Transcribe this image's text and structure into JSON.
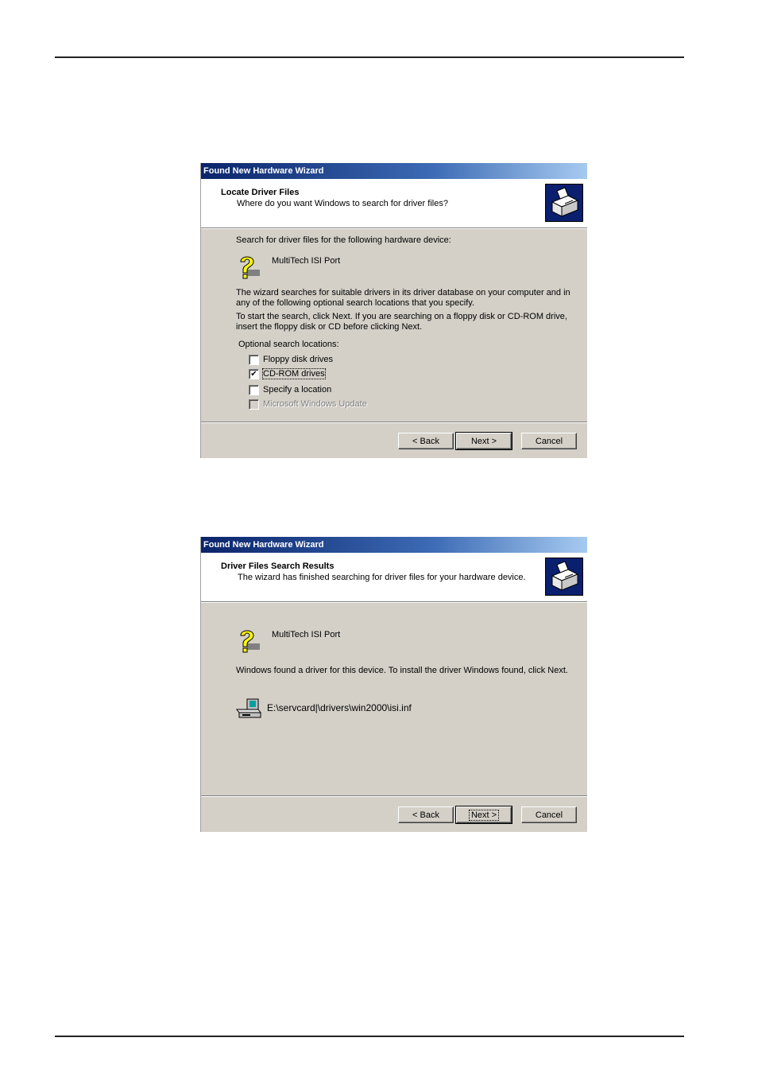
{
  "dialog1": {
    "title": "Found New Hardware Wizard",
    "header_title": "Locate Driver Files",
    "header_subtitle": "Where do you want Windows to search for driver files?",
    "intro": "Search for driver files for the following hardware device:",
    "device_name": "MultiTech ISI Port",
    "para1_line1": "The wizard searches for suitable drivers in its driver database on your computer and in",
    "para1_line2": "any of the following optional search locations that you specify.",
    "para2_line1": "To start the search, click Next. If you are searching on a floppy disk or CD-ROM drive,",
    "para2_line2": "insert the floppy disk or CD before clicking Next.",
    "optional_label": "Optional search locations:",
    "options": [
      {
        "label": "Floppy disk drives",
        "checked": "false"
      },
      {
        "label": "CD-ROM drives",
        "checked": "true"
      },
      {
        "label": "Specify a location",
        "checked": "false"
      },
      {
        "label": "Microsoft Windows Update",
        "checked": "false"
      }
    ],
    "back_label": "< Back",
    "next_label": "Next >",
    "cancel_label": "Cancel"
  },
  "dialog2": {
    "title": "Found New Hardware Wizard",
    "header_title": "Driver Files Search Results",
    "header_subtitle": "The wizard has finished searching for driver files for your hardware device.",
    "device_name": "MultiTech ISI Port",
    "message": "Windows found a driver for this device. To install the driver Windows found, click Next.",
    "driver_path": "E:\\servcard|\\drivers\\win2000\\isi.inf",
    "back_label": "< Back",
    "next_label": "Next >",
    "cancel_label": "Cancel"
  },
  "icons": {
    "wizard": "hardware-wizard-icon",
    "unknown_device": "question-mark-icon",
    "driver_file": "cd-drive-icon"
  },
  "colors": {
    "title_bar": "#0a246a",
    "dialog_face": "#d4d0c8"
  }
}
